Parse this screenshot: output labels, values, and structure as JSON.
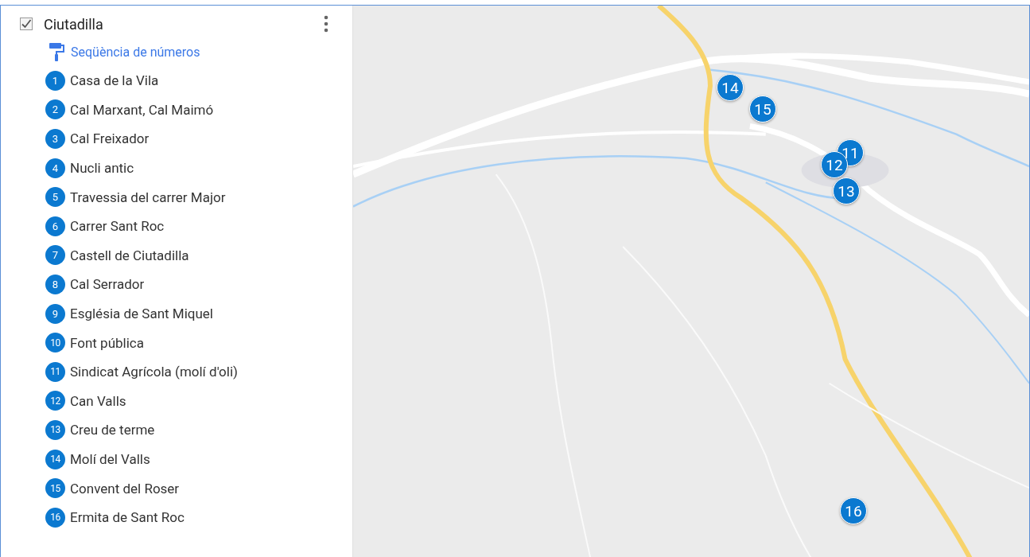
{
  "layer": {
    "title": "Ciutadilla",
    "checked": true,
    "style_link": "Seqüència de números",
    "items": [
      {
        "number": "1",
        "name": "Casa de la Vila"
      },
      {
        "number": "2",
        "name": "Cal Marxant, Cal Maimó"
      },
      {
        "number": "3",
        "name": "Cal Freixador"
      },
      {
        "number": "4",
        "name": "Nucli antic"
      },
      {
        "number": "5",
        "name": "Travessia del carrer Major"
      },
      {
        "number": "6",
        "name": "Carrer Sant Roc"
      },
      {
        "number": "7",
        "name": "Castell de Ciutadilla"
      },
      {
        "number": "8",
        "name": "Cal Serrador"
      },
      {
        "number": "9",
        "name": "Església de Sant Miquel"
      },
      {
        "number": "10",
        "name": "Font pública"
      },
      {
        "number": "11",
        "name": "Sindicat Agrícola (molí d'oli)"
      },
      {
        "number": "12",
        "name": "Can Valls"
      },
      {
        "number": "13",
        "name": "Creu de terme"
      },
      {
        "number": "14",
        "name": "Molí del Valls"
      },
      {
        "number": "15",
        "name": "Convent del Roser"
      },
      {
        "number": "16",
        "name": "Ermita de Sant Roc"
      }
    ]
  },
  "map": {
    "kind": "picture",
    "markers": [
      {
        "label": "14"
      },
      {
        "label": "15"
      },
      {
        "label": "11"
      },
      {
        "label": "12"
      },
      {
        "label": "13"
      },
      {
        "label": "16"
      }
    ]
  }
}
